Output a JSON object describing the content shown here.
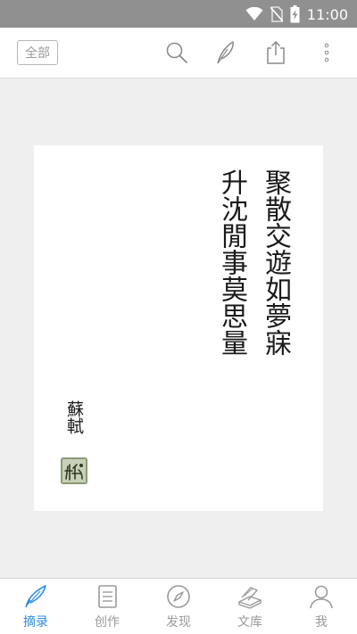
{
  "status_bar": {
    "time": "11:00",
    "icons": [
      "wifi-icon",
      "no-sim-icon",
      "battery-charging-icon"
    ]
  },
  "toolbar": {
    "filter_label": "全部",
    "icons": [
      "search-icon",
      "quill-pen-icon",
      "share-icon",
      "more-vertical-icon"
    ]
  },
  "card": {
    "poem_lines": [
      "聚散交遊如夢寐",
      "升沈閒事莫思量"
    ],
    "author": "蘇軾",
    "seal": "seal-stamp"
  },
  "tabs": [
    {
      "label": "摘录",
      "icon": "quill-pen-tab-icon",
      "active": true
    },
    {
      "label": "创作",
      "icon": "document-list-icon",
      "active": false
    },
    {
      "label": "发现",
      "icon": "compass-icon",
      "active": false
    },
    {
      "label": "文库",
      "icon": "books-icon",
      "active": false
    },
    {
      "label": "我",
      "icon": "person-icon",
      "active": false
    }
  ],
  "colors": {
    "accent": "#2e8ee0",
    "status_bar": "#909090",
    "inactive": "#9a9a9a",
    "seal": "#7f8f68"
  }
}
